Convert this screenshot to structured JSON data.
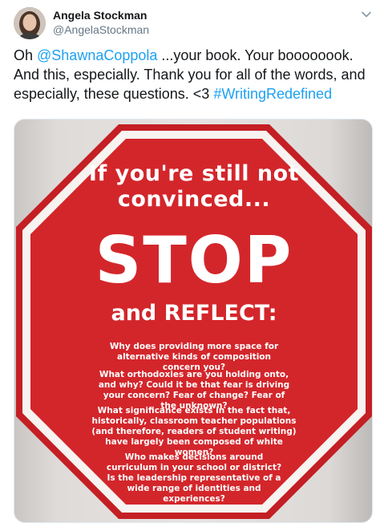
{
  "author": {
    "name": "Angela Stockman",
    "handle": "@AngelaStockman"
  },
  "tweet": {
    "prefix": "Oh ",
    "mention": "@ShawnaCoppola",
    "middle": " ...your book. Your boooooook. And this, especially. Thank you for all of the words, and especially, these questions. <3 ",
    "hashtag": "#WritingRedefined"
  },
  "image": {
    "heading": "If you're still not convinced...",
    "stop": "STOP",
    "reflect": "and REFLECT:",
    "questions": [
      "Why does providing more space for alternative kinds of composition concern you?",
      "What orthodoxies are you holding onto, and why? Could it be that fear is driving your concern? Fear of change? Fear of the unknown?",
      "What significance exists in the fact that, historically, classroom teacher populations (and therefore, readers of student writing) have largely been composed of white women?",
      "Who makes decisions around curriculum in your school or district? Is the leadership representative of a wide range of identities and experiences?"
    ],
    "colors": {
      "sign_red": "#d3262b",
      "border": "#ffffff"
    }
  },
  "icons": {
    "menu": "chevron-down-icon"
  },
  "colors": {
    "link": "#1da1f2",
    "text": "#14171a",
    "muted": "#657786"
  }
}
